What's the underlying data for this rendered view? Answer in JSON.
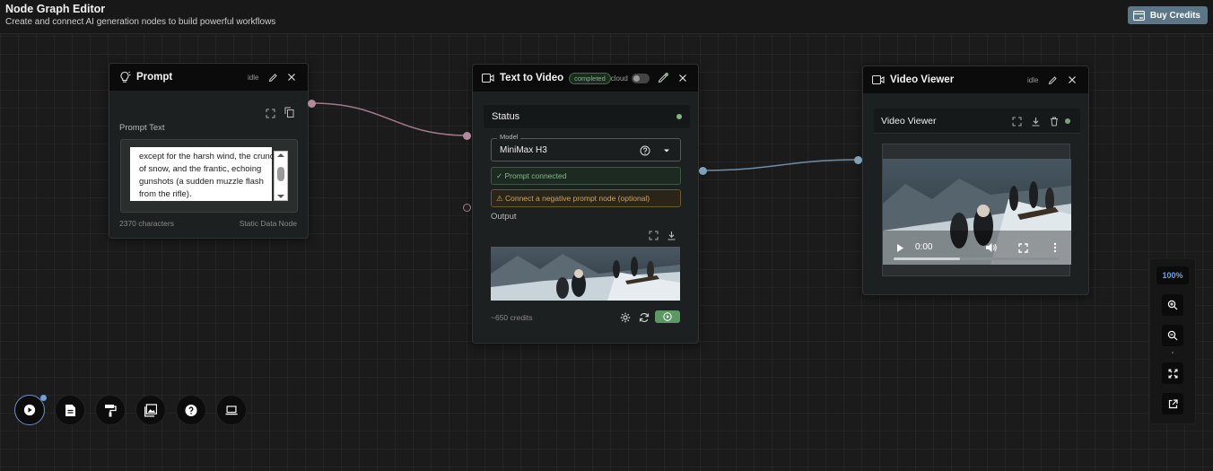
{
  "header": {
    "title": "Node Graph Editor",
    "subtitle": "Create and connect AI generation nodes to build powerful workflows",
    "buy_credits": "Buy Credits"
  },
  "prompt_node": {
    "title": "Prompt",
    "status": "idle",
    "field_label": "Prompt Text",
    "text": "except for the harsh wind, the crunch of snow, and the frantic, echoing gunshots (a sudden muzzle flash from the rifle).",
    "char_count": "2370 characters",
    "node_type": "Static Data Node"
  },
  "t2v_node": {
    "title": "Text to Video",
    "badge": "completed",
    "mode": "cloud",
    "status_label": "Status",
    "model_label": "Model",
    "model_value": "MiniMax H3",
    "prompt_connected": "✓ Prompt connected",
    "negative_hint": "⚠ Connect a negative prompt node (optional)",
    "output_label": "Output",
    "credits": "~650 credits"
  },
  "viewer_node": {
    "title": "Video Viewer",
    "status": "idle",
    "inner_title": "Video Viewer",
    "time": "0:00"
  },
  "zoom": {
    "level": "100%"
  },
  "toolbar": {
    "items": [
      "play-icon",
      "document-icon",
      "paint-roller-icon",
      "image-icon",
      "help-icon",
      "laptop-icon"
    ]
  },
  "colors": {
    "accent_blue": "#6fa0da",
    "buy_button": "#5b7687",
    "status_green": "#7fb784",
    "wire_prompt": "#a07a8a",
    "wire_video": "#6f8fa3"
  }
}
